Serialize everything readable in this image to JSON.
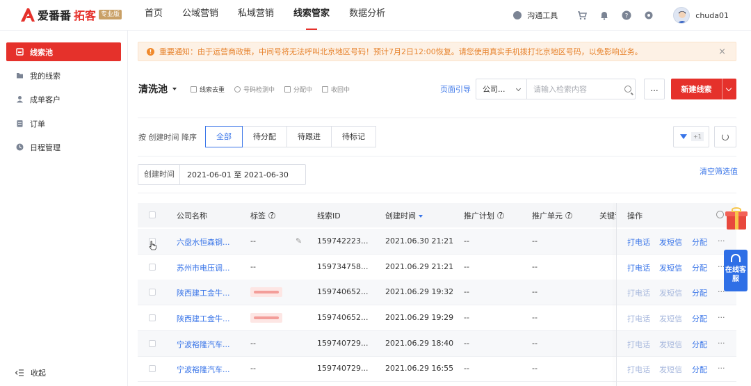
{
  "brand": {
    "name": "爱番番",
    "product": "拓客",
    "edition": "专业版"
  },
  "nav": {
    "items": [
      "首页",
      "公域营销",
      "私域营销",
      "线索管家",
      "数据分析"
    ],
    "active_index": 3
  },
  "toolbar": {
    "comm_tool": "沟通工具",
    "username": "chuda01"
  },
  "sidebar": {
    "items": [
      "线索池",
      "我的线索",
      "成单客户",
      "订单",
      "日程管理"
    ],
    "active_index": 0,
    "collapse": "收起"
  },
  "notice": {
    "text": "重要通知：由于运营商政策，中间号将无法呼叫北京地区号码！预计7月2日12:00恢复。请您使用真实手机拨打北京地区号码，以免影响业务。"
  },
  "pool": {
    "title": "清洗池",
    "actions": [
      "线索去重",
      "号码检测中",
      "分配中",
      "收回中"
    ],
    "guide": "页面引导",
    "search_type": "公司...",
    "search_placeholder": "请输入检索内容",
    "more": "...",
    "new_button": "新建线索"
  },
  "filters": {
    "sort_label": "按 创建时间 降序",
    "tabs": [
      "全部",
      "待分配",
      "待跟进",
      "待标记"
    ],
    "active_tab": 0,
    "filter_count": "+1",
    "date_label": "创建时间",
    "date_range": "2021-06-01  至  2021-06-30",
    "clear": "清空筛选值"
  },
  "table": {
    "headers": {
      "company": "公司名称",
      "tag": "标签",
      "lead_id": "线索ID",
      "created": "创建时间",
      "plan": "推广计划",
      "unit": "推广单元",
      "keyword": "关键词",
      "ops": "操作"
    },
    "ops": [
      "打电话",
      "发短信",
      "分配"
    ],
    "rows": [
      {
        "company": "六盘水恒森钢...",
        "tag": "--",
        "lead_id": "159742223...",
        "created": "2021.06.30 21:21",
        "plan": "--",
        "unit": "--",
        "tagged": false,
        "ops_enabled": true
      },
      {
        "company": "苏州市电压调...",
        "tag": "--",
        "lead_id": "159734758...",
        "created": "2021.06.29 21:21",
        "plan": "--",
        "unit": "--",
        "tagged": false,
        "ops_enabled": true
      },
      {
        "company": "陕西建工金牛...",
        "tag": "",
        "lead_id": "159740652...",
        "created": "2021.06.29 19:32",
        "plan": "--",
        "unit": "--",
        "tagged": true,
        "ops_enabled": false
      },
      {
        "company": "陕西建工金牛...",
        "tag": "",
        "lead_id": "159740652...",
        "created": "2021.06.29 19:29",
        "plan": "--",
        "unit": "--",
        "tagged": true,
        "ops_enabled": false
      },
      {
        "company": "宁波裕隆汽车...",
        "tag": "--",
        "lead_id": "159740729...",
        "created": "2021.06.29 18:40",
        "plan": "--",
        "unit": "--",
        "tagged": false,
        "ops_enabled": false
      },
      {
        "company": "宁波裕隆汽车...",
        "tag": "--",
        "lead_id": "159740729...",
        "created": "2021.06.29 16:55",
        "plan": "--",
        "unit": "--",
        "tagged": false,
        "ops_enabled": false
      }
    ]
  },
  "service": {
    "label": "在线客服"
  }
}
